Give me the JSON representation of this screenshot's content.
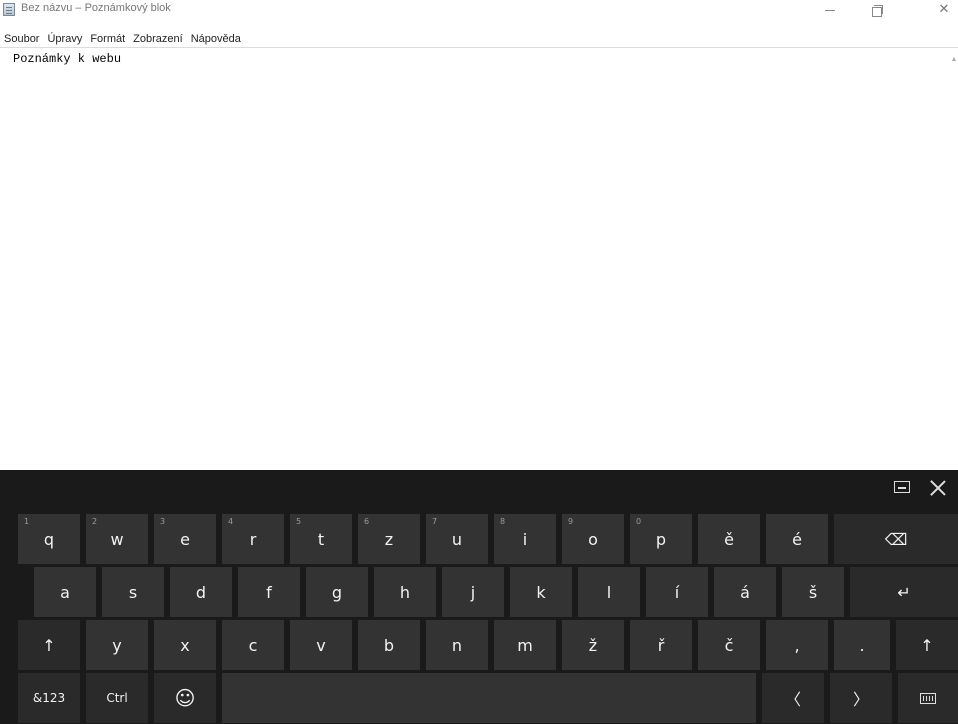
{
  "window": {
    "title": "Bez názvu – Poznámkový blok"
  },
  "menu": [
    "Soubor",
    "Úpravy",
    "Formát",
    "Zobrazení",
    "Nápověda"
  ],
  "editor": {
    "content": "Poznámky k webu"
  },
  "keyboard": {
    "row1": [
      {
        "label": "q",
        "sub": "1"
      },
      {
        "label": "w",
        "sub": "2"
      },
      {
        "label": "e",
        "sub": "3"
      },
      {
        "label": "r",
        "sub": "4"
      },
      {
        "label": "t",
        "sub": "5"
      },
      {
        "label": "z",
        "sub": "6"
      },
      {
        "label": "u",
        "sub": "7"
      },
      {
        "label": "i",
        "sub": "8"
      },
      {
        "label": "o",
        "sub": "9"
      },
      {
        "label": "p",
        "sub": "0"
      },
      {
        "label": "ě",
        "sub": ""
      },
      {
        "label": "é",
        "sub": ""
      }
    ],
    "backspace": "⌫",
    "row2": [
      "a",
      "s",
      "d",
      "f",
      "g",
      "h",
      "j",
      "k",
      "l",
      "í",
      "á",
      "š"
    ],
    "enter": "↵",
    "shift": "↑",
    "row3": [
      "y",
      "x",
      "c",
      "v",
      "b",
      "n",
      "m",
      "ž",
      "ř",
      "č",
      ",",
      "."
    ],
    "symbols_label": "&123",
    "ctrl_label": "Ctrl",
    "emoji": "☺",
    "left_arrow": "〈",
    "right_arrow": "〉"
  }
}
